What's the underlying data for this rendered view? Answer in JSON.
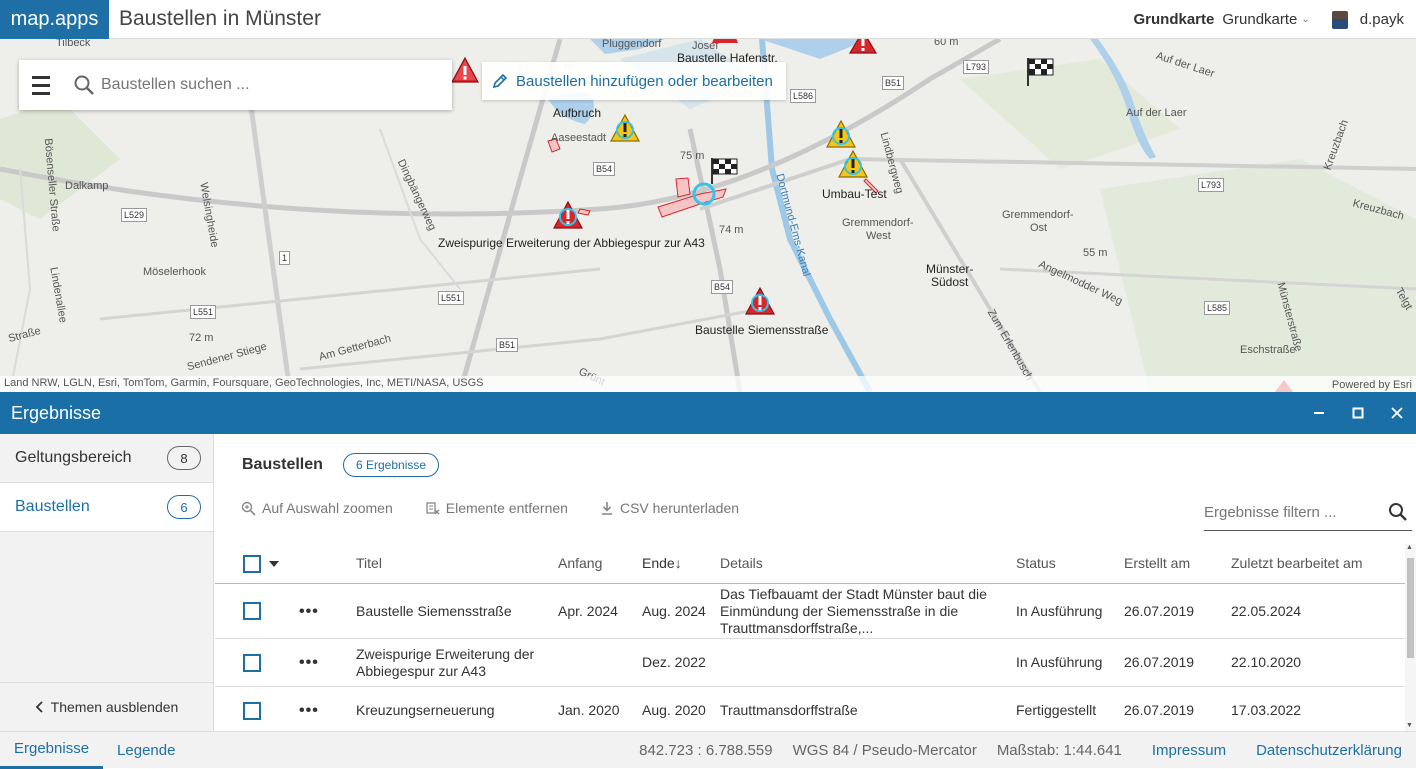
{
  "header": {
    "logo": "map.apps",
    "title": "Baustellen in Münster",
    "basemap_label": "Grundkarte",
    "basemap_select": "Grundkarte",
    "user": "d.payk"
  },
  "map": {
    "search_placeholder": "Baustellen suchen ...",
    "edit_button": "Baustellen hinzufügen oder bearbeiten",
    "attribution": "Land NRW, LGLN, Esri, TomTom, Garmin, Foursquare, GeoTechnologies, Inc, METI/NASA, USGS",
    "powered_by": "Powered by Esri",
    "labels": {
      "tilbeck": "Tilbeck",
      "pluggendorf": "Pluggendorf",
      "hafen": "Baustelle Hafenstr.",
      "josef": "Josef",
      "aufbruch": "Aufbruch",
      "aaseestadt": "Aaseestadt",
      "umbau": "Umbau-Test",
      "erweiterung": "Zweispurige Erweiterung der Abbiegespur zur A43",
      "siemens": "Baustelle Siemensstraße",
      "muenster_suedost_1": "Münster-",
      "muenster_suedost_2": "Südost",
      "gremmendorf_ost_1": "Gremmendorf-",
      "gremmendorf_ost_2": "Ost",
      "gremmendorf_west_1": "Gremmendorf-",
      "gremmendorf_west_2": "West",
      "dalkamp": "Dalkamp",
      "moeselerhook": "Möselerhook",
      "lindenallee": "Lindenallee",
      "boesensell": "Bösenseller Straße",
      "welsingheide": "Welsingheide",
      "dingbaenger": "Dingbängerweg",
      "amgetterbach": "Am Getterbach",
      "sendener": "Sendener Stiege",
      "kanal": "Dortmund-Ems-Kanal",
      "lindberg": "Lindbergweg",
      "angelmodder": "Angelmodder Weg",
      "aufderlaer1": "Auf der Laer",
      "aufderlaer2": "Auf der Laer",
      "kreuzbach1": "Kreuzbach",
      "kreuzbach2": "Kreuzbach",
      "muensterstr": "Münsterstraße",
      "eschstr": "Eschstraße",
      "erlenbusch": "Zum Erlenbusch",
      "telgter": "Telgt",
      "straesse": "Straße",
      "gravenhorst": "Grünt",
      "m60": "60 m",
      "m75": "75 m",
      "m74": "74 m",
      "m55": "55 m",
      "m72": "72 m",
      "badge_b51a": "B51",
      "badge_l793a": "L793",
      "badge_l586": "L586",
      "badge_b54a": "B54",
      "badge_l529": "L529",
      "badge_1": "1",
      "badge_l551a": "L551",
      "badge_l551b": "L551",
      "badge_b54b": "B54",
      "badge_b51b": "B51",
      "badge_l793b": "L793",
      "badge_l585": "L585"
    }
  },
  "panel": {
    "title": "Ergebnisse",
    "sidebar": [
      {
        "label": "Geltungsbereich",
        "count": "8"
      },
      {
        "label": "Baustellen",
        "count": "6"
      }
    ],
    "hide_themes": "Themen ausblenden",
    "content_title": "Baustellen",
    "results_chip": "6 Ergebnisse",
    "tools": {
      "zoom": "Auf Auswahl zoomen",
      "remove": "Elemente entfernen",
      "csv": "CSV herunterladen"
    },
    "filter_placeholder": "Ergebnisse filtern ...",
    "columns": {
      "title": "Titel",
      "start": "Anfang",
      "end": "Ende",
      "sort_arrow": "↓",
      "details": "Details",
      "status": "Status",
      "created": "Erstellt am",
      "edited": "Zuletzt bearbeitet am"
    },
    "rows": [
      {
        "title": "Baustelle Siemensstraße",
        "start": "Apr. 2024",
        "end": "Aug. 2024",
        "details": "Das Tiefbauamt der Stadt Münster baut die Einmündung der Siemensstraße in die Trauttmansdorffstraße,...",
        "status": "In Ausführung",
        "created": "26.07.2019",
        "edited": "22.05.2024"
      },
      {
        "title": "Zweispurige Erweiterung der Abbiegespur zur A43",
        "start": "",
        "end": "Dez. 2022",
        "details": "",
        "status": "In Ausführung",
        "created": "26.07.2019",
        "edited": "22.10.2020"
      },
      {
        "title": "Kreuzungserneuerung",
        "start": "Jan. 2020",
        "end": "Aug. 2020",
        "details": "Trauttmansdorffstraße",
        "status": "Fertiggestellt",
        "created": "26.07.2019",
        "edited": "17.03.2022"
      }
    ]
  },
  "footer": {
    "tab_results": "Ergebnisse",
    "tab_legend": "Legende",
    "coords": "842.723 : 6.788.559",
    "crs": "WGS 84 / Pseudo-Mercator",
    "scale": "Maßstab: 1:44.641",
    "impressum": "Impressum",
    "privacy": "Datenschutzerklärung"
  },
  "colors": {
    "brand_blue": "#1d6fa5",
    "panel_header": "#1b6fa7",
    "warning_red": "#d9262c",
    "warning_yellow": "#f5c518"
  }
}
